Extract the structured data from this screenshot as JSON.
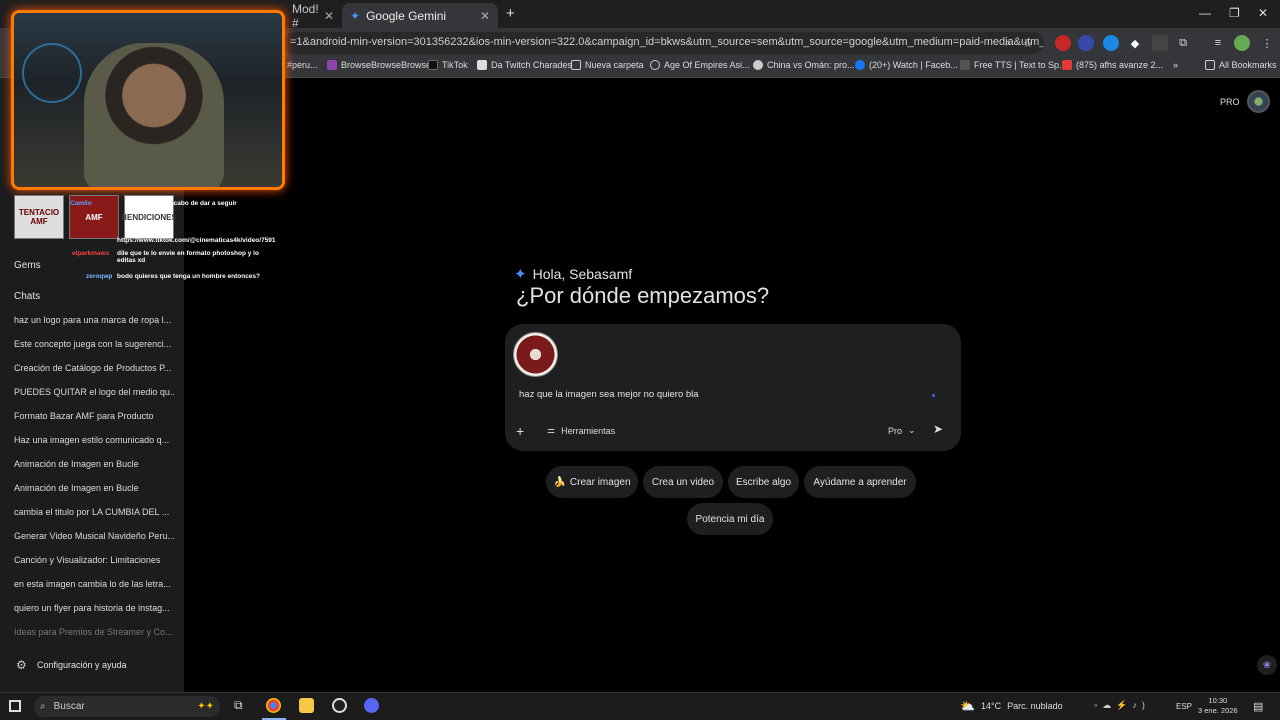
{
  "browser": {
    "tabs": [
      {
        "title": "Mod! #"
      },
      {
        "title": "Google Gemini"
      }
    ],
    "new_tab_symbol": "+",
    "close_symbol": "✕",
    "address": "=1&android-min-version=301356232&ios-min-version=322.0&campaign_id=bkws&utm_source=sem&utm_source=google&utm_medium=paid-media&utm_medium=...",
    "bookmarks": [
      {
        "label": "#peru..."
      },
      {
        "label": "BrowseBrowseBrowse"
      },
      {
        "label": "TikTok"
      },
      {
        "label": "Da Twitch Charades"
      },
      {
        "label": "Nueva carpeta"
      },
      {
        "label": "Age Of Empires Asi..."
      },
      {
        "label": "China vs Omán: pro..."
      },
      {
        "label": "(20+) Watch | Faceb..."
      },
      {
        "label": "Free TTS | Text to Sp..."
      },
      {
        "label": "(875) afhs avanze 2..."
      }
    ],
    "all_bookmarks": "All Bookmarks",
    "more_symbol": "»"
  },
  "stream_overlay": {
    "thumbs": [
      "TENTACIO AMF",
      "AMF",
      "BENDICIONES"
    ],
    "chat": [
      {
        "user": "Camilo",
        "text": "...justo le acabo de dar a seguir",
        "color": "#4fa3ff"
      },
      {
        "user": "",
        "text": "https://www.tiktok.com/@cinematicas4k/video/7591",
        "color": "#4fa3ff"
      },
      {
        "user": "elparkmaws",
        "text": "dile que te lo envie en formato photoshop y lo editas xd",
        "color": "#ff4040"
      },
      {
        "user": "zeroqwp",
        "text": "bodo quieres que tenga un hombre entonces?",
        "color": "#7fb7ff"
      }
    ]
  },
  "sidebar": {
    "gems_label": "Gems",
    "chats_label": "Chats",
    "chats": [
      "haz un logo para una marca de ropa l...",
      "Este concepto juega con la sugerenci...",
      "Creación de Catálogo de Productos P...",
      "PUEDES QUITAR el logo del medio qu...",
      "Formato Bazar AMF para Producto",
      "Haz una imagen estilo comunicado q...",
      "Animación de Imagen en Bucle",
      "Animación de Imagen en Bucle",
      "cambia el titulo por LA CUMBIA DEL ...",
      "Generar Video Musical Navideño Peru...",
      "Canción y Visualizador: Limitaciones",
      "en esta imagen cambia lo de las letra...",
      "quiero un flyer para historia de instag...",
      "Ideas para Premios de Streamer y Co..."
    ],
    "settings_label": "Configuración y ayuda"
  },
  "header": {
    "pro_label": "PRO"
  },
  "main": {
    "greeting": "Hola, Sebasamf",
    "headline": "¿Por dónde empezamos?",
    "prompt_text": "haz que la imagen sea mejor no quiero bla",
    "plus_symbol": "+",
    "tools_label": "Herramientas",
    "model_label": "Pro",
    "chips": [
      {
        "label": "Crear imagen",
        "icon": "🍌"
      },
      {
        "label": "Crea un video",
        "icon": ""
      },
      {
        "label": "Escribe algo",
        "icon": ""
      },
      {
        "label": "Ayúdame a aprender",
        "icon": ""
      },
      {
        "label": "Potencia mi día",
        "icon": ""
      }
    ]
  },
  "taskbar": {
    "search_placeholder": "Buscar",
    "weather_temp": "14°C",
    "weather_text": "Parc. nublado",
    "lang": "ESP",
    "time": "10:30",
    "date": "3 ene. 2026"
  },
  "colors": {
    "accent_orange": "#ff7b00",
    "gemini_blue": "#4b8df8",
    "background": "#000000",
    "sidebar": "#1b1c1d",
    "composer": "#1e1f20"
  }
}
